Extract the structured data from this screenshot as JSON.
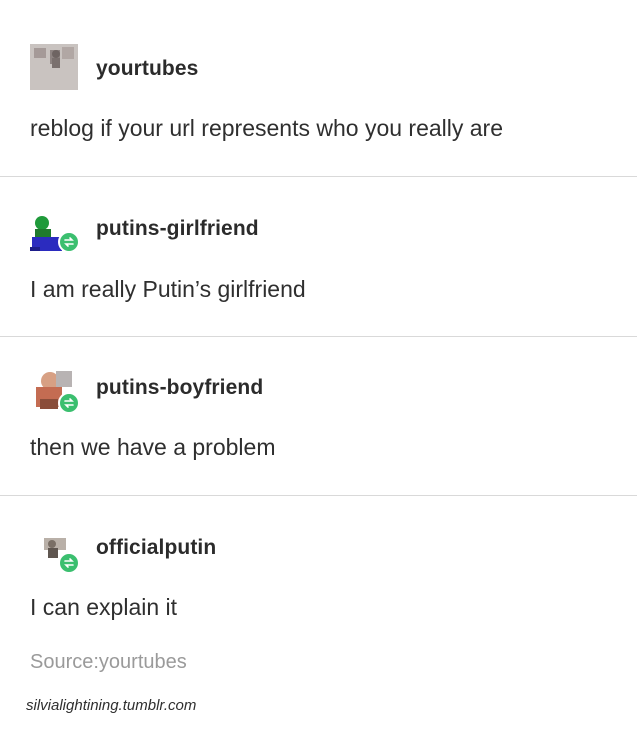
{
  "posts": [
    {
      "username": "yourtubes",
      "text": "reblog if your url represents who you really are",
      "avatar_icon": "photo-avatar-icon"
    },
    {
      "username": "putins-girlfriend",
      "text": "I am really Putin’s girlfriend",
      "avatar_icon": "figure-avatar-icon",
      "badge_icon": "reblog-icon"
    },
    {
      "username": "putins-boyfriend",
      "text": "then we have a problem",
      "avatar_icon": "photo-avatar-icon",
      "badge_icon": "reblog-icon"
    },
    {
      "username": "officialputin",
      "text": "I can explain it",
      "avatar_icon": "photo-avatar-icon",
      "badge_icon": "reblog-icon"
    }
  ],
  "source": {
    "text": "Source:yourtubes"
  },
  "watermark": {
    "text": "silvialightining.tumblr.com"
  },
  "colors": {
    "reblog_badge": "#3bbf6f",
    "divider": "#d9d9d9",
    "source_text": "#9a9a9a"
  }
}
